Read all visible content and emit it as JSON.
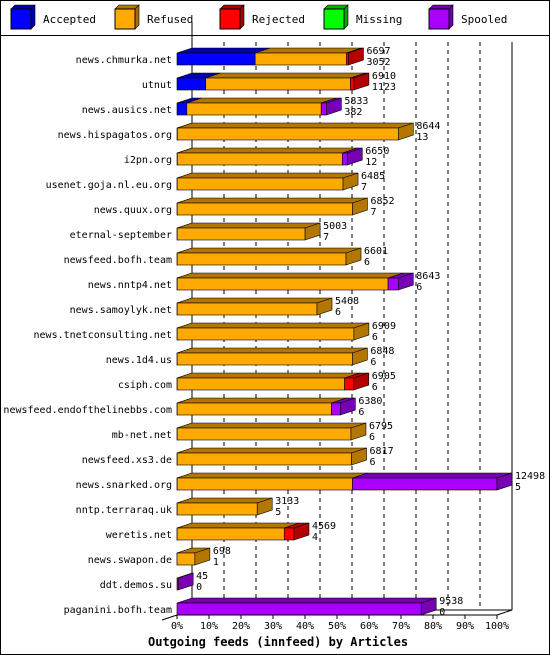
{
  "chart_data": {
    "type": "bar",
    "orientation": "horizontal",
    "stacked": true,
    "style": "3d",
    "title": "Outgoing feeds (innfeed) by Articles",
    "xlabel": "",
    "ylabel": "",
    "xlim": [
      0,
      100
    ],
    "x_unit": "% of max total (12498 articles)",
    "x_ticks": [
      "0%",
      "10%",
      "20%",
      "30%",
      "40%",
      "50%",
      "60%",
      "70%",
      "80%",
      "90%",
      "100%"
    ],
    "grid": true,
    "legend_position": "top",
    "legend": [
      {
        "name": "Accepted",
        "color": "#0000ff"
      },
      {
        "name": "Refused",
        "color": "#ffaa00"
      },
      {
        "name": "Rejected",
        "color": "#ff0000"
      },
      {
        "name": "Missing",
        "color": "#00ff00"
      },
      {
        "name": "Spooled",
        "color": "#aa00ff"
      }
    ],
    "categories": [
      "news.chmurka.net",
      "utnut",
      "news.ausics.net",
      "news.hispagatos.org",
      "i2pn.org",
      "usenet.goja.nl.eu.org",
      "news.quux.org",
      "eternal-september",
      "newsfeed.bofh.team",
      "news.nntp4.net",
      "news.samoylyk.net",
      "news.tnetconsulting.net",
      "news.1d4.us",
      "csiph.com",
      "newsfeed.endofthelinebbs.com",
      "mb-net.net",
      "newsfeed.xs3.de",
      "news.snarked.org",
      "nntp.terraraq.uk",
      "weretis.net",
      "news.swapon.de",
      "ddt.demos.su",
      "paganini.bofh.team"
    ],
    "totals": [
      6697,
      6910,
      5833,
      8644,
      6650,
      6485,
      6852,
      5003,
      6601,
      8643,
      5468,
      6909,
      6848,
      6905,
      6380,
      6795,
      6817,
      12498,
      3133,
      4569,
      698,
      45,
      9538
    ],
    "accepted_labels": [
      3052,
      1123,
      382,
      13,
      12,
      7,
      7,
      7,
      6,
      6,
      6,
      6,
      6,
      6,
      6,
      6,
      6,
      5,
      5,
      4,
      1,
      0,
      0
    ],
    "series": [
      {
        "name": "Accepted",
        "values": [
          3052,
          1123,
          382,
          13,
          12,
          7,
          7,
          7,
          6,
          6,
          6,
          6,
          6,
          6,
          6,
          6,
          6,
          5,
          5,
          4,
          1,
          0,
          0
        ]
      },
      {
        "name": "Refused",
        "values": [
          3560,
          5650,
          5250,
          8631,
          6448,
          6478,
          6845,
          4996,
          6595,
          8237,
          5462,
          6903,
          6842,
          6539,
          6025,
          6789,
          6811,
          6850,
          3128,
          4185,
          697,
          0,
          0
        ]
      },
      {
        "name": "Rejected",
        "values": [
          85,
          137,
          0,
          0,
          0,
          0,
          0,
          0,
          0,
          0,
          0,
          0,
          0,
          360,
          0,
          0,
          0,
          0,
          0,
          380,
          0,
          0,
          0
        ]
      },
      {
        "name": "Missing",
        "values": [
          0,
          0,
          0,
          0,
          0,
          0,
          0,
          0,
          0,
          0,
          0,
          0,
          0,
          0,
          0,
          0,
          0,
          0,
          0,
          0,
          0,
          0,
          0
        ]
      },
      {
        "name": "Spooled",
        "values": [
          0,
          0,
          201,
          0,
          190,
          0,
          0,
          0,
          0,
          400,
          0,
          0,
          0,
          0,
          349,
          0,
          0,
          5643,
          0,
          0,
          0,
          45,
          9538
        ]
      }
    ]
  }
}
